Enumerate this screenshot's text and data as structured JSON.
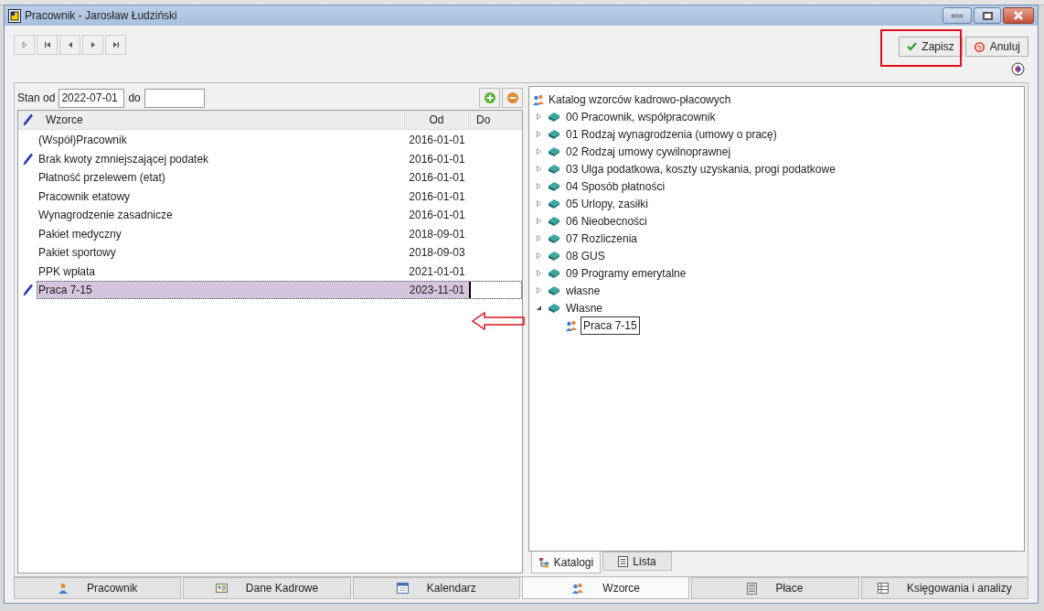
{
  "window": {
    "title": "Pracownik - Jarosław Łudziński"
  },
  "toolbar": {
    "buttons": [
      {
        "label": "Zapisz",
        "kind": "save"
      },
      {
        "label": "Anuluj",
        "kind": "cancel"
      }
    ]
  },
  "filter": {
    "from_label": "Stan od",
    "from_value": "2022-07-01",
    "to_label": "do"
  },
  "table": {
    "columns": [
      "Wzorce",
      "Od",
      "Do"
    ],
    "rows": [
      {
        "name": "(Współ)Pracownik",
        "od": "2016-01-01",
        "edited": false,
        "selected": false
      },
      {
        "name": "Brak kwoty zmniejszającej podatek",
        "od": "2016-01-01",
        "edited": true,
        "selected": false
      },
      {
        "name": "Płatność przelewem (etat)",
        "od": "2016-01-01",
        "edited": false,
        "selected": false
      },
      {
        "name": "Pracownik etatowy",
        "od": "2016-01-01",
        "edited": false,
        "selected": false
      },
      {
        "name": "Wynagrodzenie zasadnicze",
        "od": "2016-01-01",
        "edited": false,
        "selected": false
      },
      {
        "name": "Pakiet medyczny",
        "od": "2018-09-01",
        "edited": false,
        "selected": false
      },
      {
        "name": "Pakiet sportowy",
        "od": "2018-09-03",
        "edited": false,
        "selected": false
      },
      {
        "name": "PPK wpłata",
        "od": "2021-01-01",
        "edited": false,
        "selected": false
      },
      {
        "name": "Praca 7-15",
        "od": "2023-11-01",
        "edited": true,
        "selected": true
      }
    ]
  },
  "tree": {
    "root": "Katalog wzorców kadrowo-płacowych",
    "children": [
      {
        "label": "00 Pracownik, współpracownik",
        "expanded": false
      },
      {
        "label": "01 Rodzaj wynagrodzenia (umowy o pracę)",
        "expanded": false
      },
      {
        "label": "02 Rodzaj umowy cywilnoprawnej",
        "expanded": false
      },
      {
        "label": "03 Ulga podatkowa, koszty uzyskania, progi podatkowe",
        "expanded": false
      },
      {
        "label": "04 Sposób płatności",
        "expanded": false
      },
      {
        "label": "05 Urlopy, zasiłki",
        "expanded": false
      },
      {
        "label": "06 Nieobecności",
        "expanded": false
      },
      {
        "label": "07 Rozliczenia",
        "expanded": false
      },
      {
        "label": "08 GUS",
        "expanded": false
      },
      {
        "label": "09 Programy emerytalne",
        "expanded": false
      },
      {
        "label": "własne",
        "expanded": false
      },
      {
        "label": "Własne",
        "expanded": true,
        "children": [
          {
            "label": "Praca 7-15",
            "selected": true
          }
        ]
      }
    ]
  },
  "tree_tabs": [
    {
      "label": "Katalogi",
      "selected": true
    },
    {
      "label": "Lista",
      "selected": false
    }
  ],
  "bottom_tabs": [
    {
      "label": "Pracownik",
      "selected": false
    },
    {
      "label": "Dane Kadrowe",
      "selected": false
    },
    {
      "label": "Kalendarz",
      "selected": false
    },
    {
      "label": "Wzorce",
      "selected": true
    },
    {
      "label": "Płace",
      "selected": false
    },
    {
      "label": "Księgowania i analizy",
      "selected": false
    }
  ]
}
